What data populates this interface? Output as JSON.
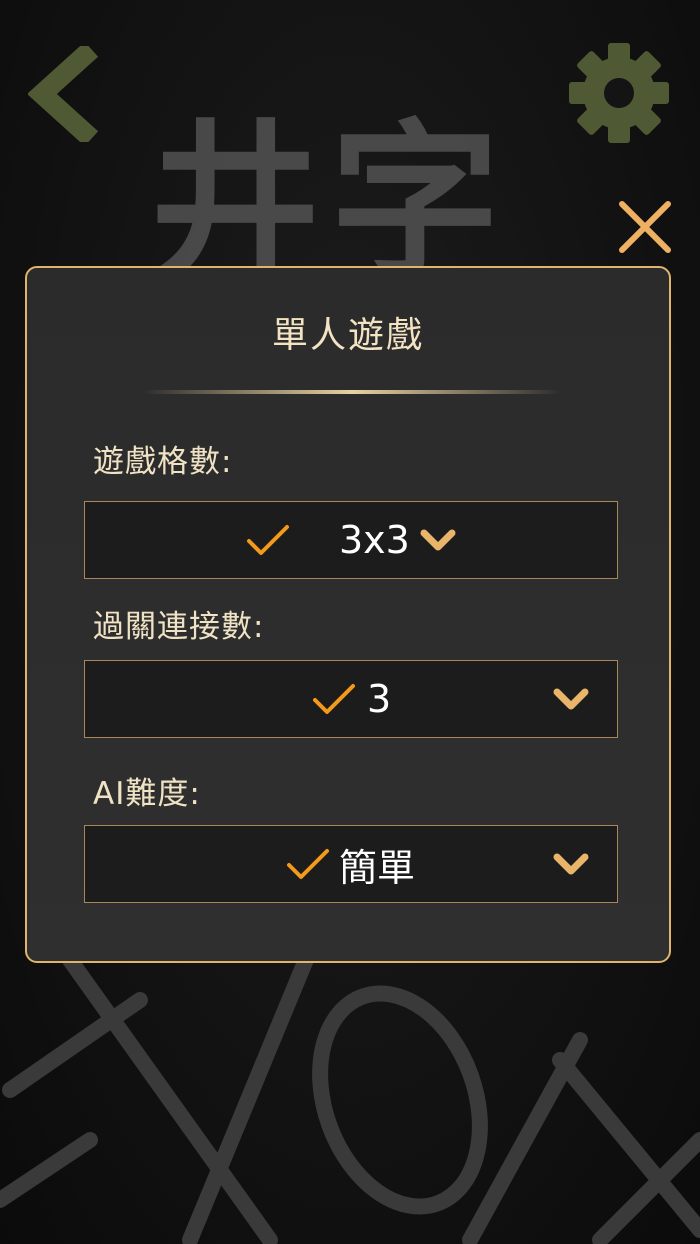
{
  "background": {
    "title": "井字"
  },
  "dialog": {
    "title": "單人遊戲",
    "fields": [
      {
        "label": "遊戲格數:",
        "value": "3x3"
      },
      {
        "label": "過關連接數:",
        "value": "3"
      },
      {
        "label": "AI難度:",
        "value": "簡單"
      }
    ]
  },
  "icons": {
    "back": "chevron-left-icon",
    "settings": "gear-icon",
    "close": "close-icon",
    "selected": "check-icon",
    "dropdown": "chevron-down-icon"
  },
  "colors": {
    "accent_gold": "#e0b46a",
    "check_orange": "#f29a1b",
    "icon_olive": "#4f5a34",
    "close_orange": "#f0b062"
  }
}
